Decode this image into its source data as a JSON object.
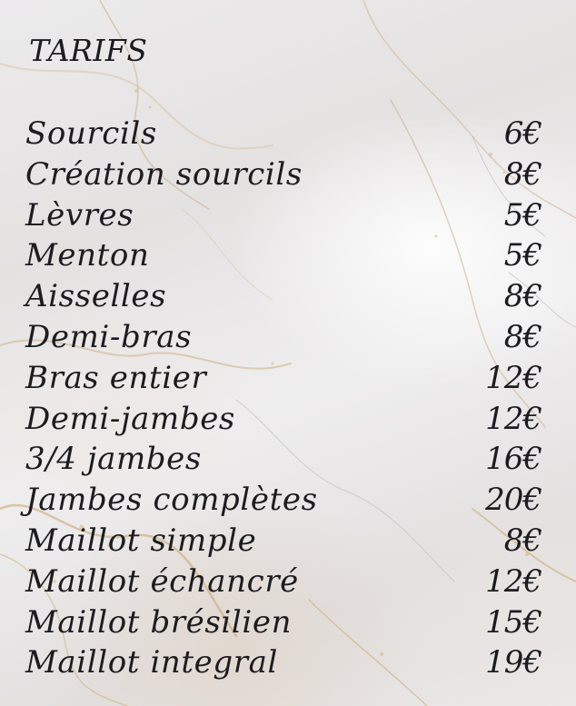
{
  "title": "TARIFS",
  "items": [
    {
      "service": "Sourcils",
      "price": "6€"
    },
    {
      "service": "Création sourcils",
      "price": "8€"
    },
    {
      "service": "Lèvres",
      "price": "5€"
    },
    {
      "service": "Menton",
      "price": "5€"
    },
    {
      "service": "Aisselles",
      "price": "8€"
    },
    {
      "service": "Demi-bras",
      "price": "8€"
    },
    {
      "service": "Bras entier",
      "price": "12€"
    },
    {
      "service": "Demi-jambes",
      "price": "12€"
    },
    {
      "service": "3/4 jambes",
      "price": "16€"
    },
    {
      "service": "Jambes complètes",
      "price": "20€"
    },
    {
      "service": "Maillot simple",
      "price": "8€"
    },
    {
      "service": "Maillot échancré",
      "price": "12€"
    },
    {
      "service": "Maillot brésilien",
      "price": "15€"
    },
    {
      "service": "Maillot integral",
      "price": "19€"
    }
  ],
  "colors": {
    "text": "#1c1c20",
    "marble_base": "#e9e7e7",
    "gold_vein": "#c9a46a"
  }
}
